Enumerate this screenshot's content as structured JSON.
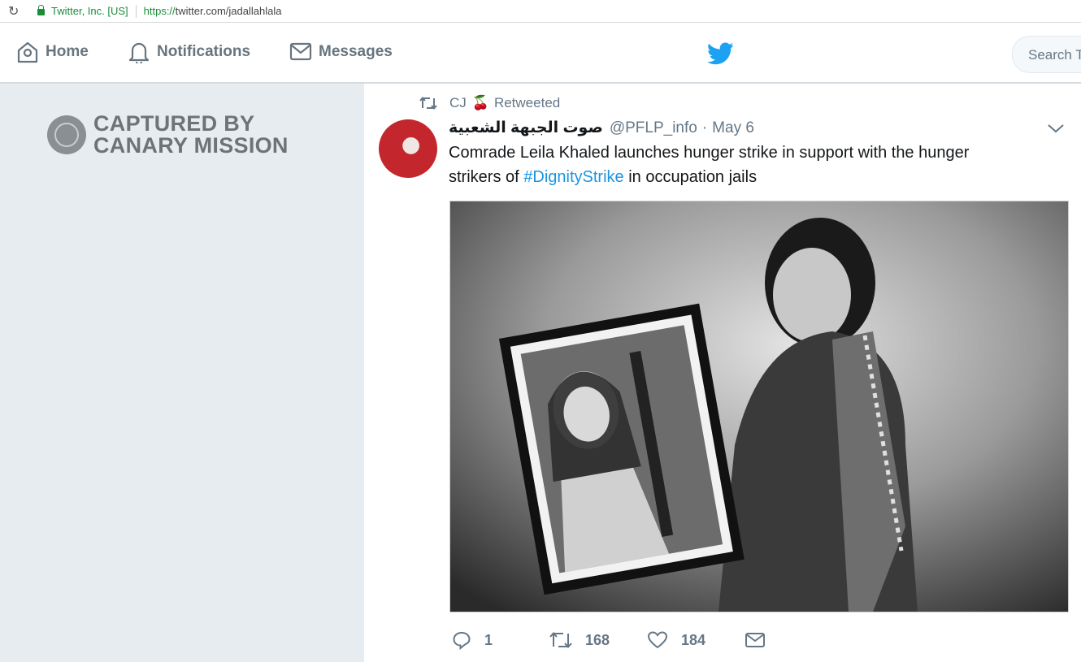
{
  "browser": {
    "reload_icon": "reload-icon",
    "cert_label": "Twitter, Inc. [US]",
    "url_protocol": "https://",
    "url_rest": "twitter.com/jadallahlala"
  },
  "nav": {
    "home": "Home",
    "notifications": "Notifications",
    "messages": "Messages",
    "search_placeholder": "Search Twitter"
  },
  "sidebar": {
    "watermark_line1": "CAPTURED BY",
    "watermark_line2": "CANARY MISSION"
  },
  "tweet": {
    "retweeter": "CJ",
    "retweeter_emoji": "🍒",
    "retweet_label": "Retweeted",
    "author_name": "صوت الجبهة الشعبية",
    "handle": "@PFLP_info",
    "dot": "·",
    "date": "May 6",
    "text_before": "Comrade Leila Khaled launches hunger strike in support with the hunger strikers of ",
    "hashtag": "#DignityStrike",
    "text_after": " in occupation jails",
    "replies": "1",
    "retweets": "168",
    "likes": "184"
  },
  "colors": {
    "accent": "#1da1f2",
    "link": "#1b95e0",
    "muted": "#657786",
    "panel_bg": "#e6ecf0"
  }
}
